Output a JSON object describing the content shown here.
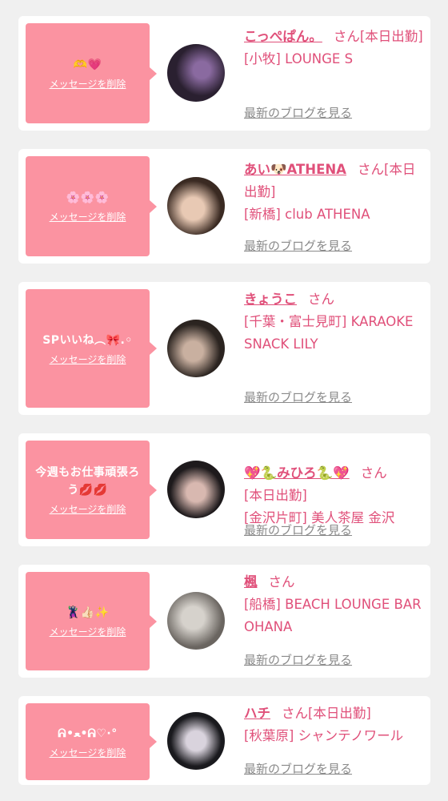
{
  "common": {
    "delete_label": "メッセージを削除",
    "blog_label": "最新のブログを見る",
    "san": "さん"
  },
  "items": [
    {
      "message": "🫶💗",
      "name": "こっぺぱん。",
      "after_name": "[本日出勤]",
      "shop": "[小牧] LOUNGE S",
      "avatar_colors": [
        "#2a2030",
        "#8a6aa0"
      ]
    },
    {
      "message": "🌸🌸🌸",
      "name": "あい🐶ATHENA",
      "after_name": "[本日出勤]",
      "shop": "[新橋] club ATHENA",
      "avatar_colors": [
        "#3a2a22",
        "#e8c9b4"
      ]
    },
    {
      "message": "SPいいね︵🎀.◦",
      "name": "きょうこ",
      "after_name": "",
      "shop": "[千葉・富士見町] KARAOKE SNACK LILY",
      "avatar_colors": [
        "#2b2420",
        "#c9b0a0"
      ]
    },
    {
      "message": "今週もお仕事頑張ろう💋💋",
      "name": "💖🐍みひろ🐍💖",
      "after_name": "",
      "shop": "[本日出勤]\n[金沢片町] 美人茶屋 金沢",
      "avatar_colors": [
        "#1e1a1c",
        "#d8b8b0"
      ]
    },
    {
      "message": "🦹👍🏻✨",
      "name": "楓",
      "after_name": "",
      "shop": "[船橋] BEACH LOUNGE BAR OHANA",
      "avatar_colors": [
        "#6a6560",
        "#d6d2cc"
      ]
    },
    {
      "message": "ᕱ•ﻌ•ᕱ♡·°",
      "name": "ハチ",
      "after_name": "[本日出勤]",
      "shop": "[秋葉原] シャンテノワール",
      "avatar_colors": [
        "#1a1a1e",
        "#d9d3dd"
      ]
    }
  ]
}
